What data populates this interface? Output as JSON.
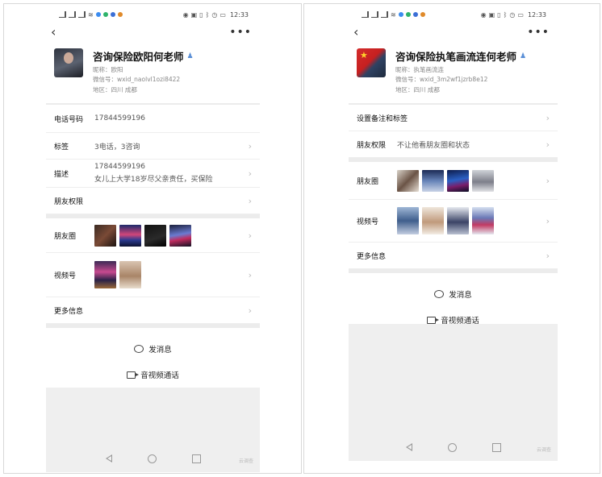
{
  "status": {
    "time": "12:33"
  },
  "left": {
    "name": "咨询保险欧阳何老师",
    "nickname": "昵称：欧阳",
    "wechat_id": "微信号：wxid_naolvl1ozi8422",
    "region": "地区：四川 成都",
    "phone_label": "电话号码",
    "phone_value": "17844599196",
    "tag_label": "标签",
    "tag_value": "3电话，3咨询",
    "desc_label": "描述",
    "desc_line1": "17844599196",
    "desc_line2": "女儿上大学18岁尽父亲责任，买保险",
    "friend_perm_label": "朋友权限",
    "moments_label": "朋友圈",
    "channels_label": "视频号",
    "more_info_label": "更多信息",
    "send_msg": "发消息",
    "av_call": "音视频通话",
    "watermark": "云调查"
  },
  "right": {
    "name": "咨询保险执笔画流连何老师",
    "nickname": "昵称：执笔画流连",
    "wechat_id": "微信号：wxid_3m2wf1jzrb8e12",
    "region": "地区：四川 成都",
    "remark_label": "设置备注和标签",
    "friend_perm_label": "朋友权限",
    "friend_perm_value": "不让他看朋友圈和状态",
    "moments_label": "朋友圈",
    "channels_label": "视频号",
    "more_info_label": "更多信息",
    "send_msg": "发消息",
    "av_call": "音视频通话",
    "watermark": "云调查"
  },
  "colors": {
    "accent": "#5a8fd6",
    "divider": "#ececec",
    "gray_area": "#efefef"
  }
}
